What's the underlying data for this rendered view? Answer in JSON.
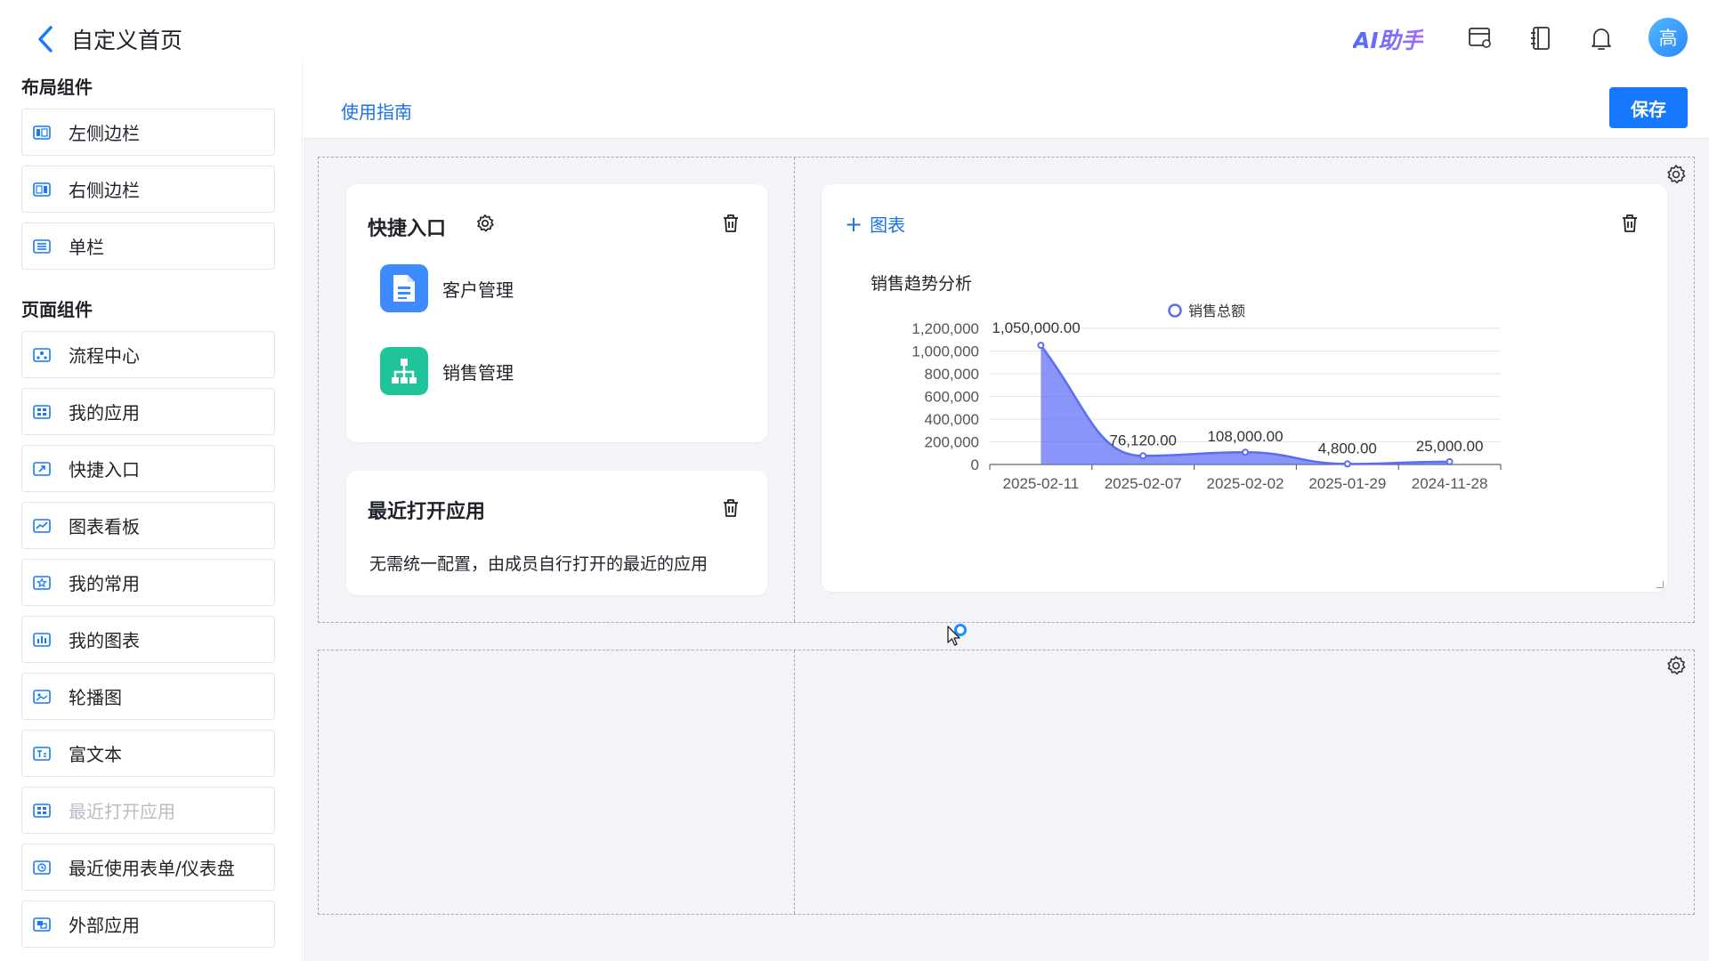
{
  "header": {
    "title": "自定义首页",
    "ai_label": "AI助手",
    "avatar_text": "高"
  },
  "sidebar": {
    "layout_section": "布局组件",
    "layout_items": [
      {
        "label": "左侧边栏",
        "icon": "left-sidebar-icon"
      },
      {
        "label": "右侧边栏",
        "icon": "right-sidebar-icon"
      },
      {
        "label": "单栏",
        "icon": "single-column-icon"
      }
    ],
    "page_section": "页面组件",
    "page_items": [
      {
        "label": "流程中心",
        "icon": "process-icon"
      },
      {
        "label": "我的应用",
        "icon": "apps-icon"
      },
      {
        "label": "快捷入口",
        "icon": "shortcut-icon"
      },
      {
        "label": "图表看板",
        "icon": "chart-board-icon"
      },
      {
        "label": "我的常用",
        "icon": "star-icon"
      },
      {
        "label": "我的图表",
        "icon": "bar-chart-icon"
      },
      {
        "label": "轮播图",
        "icon": "carousel-icon"
      },
      {
        "label": "富文本",
        "icon": "rich-text-icon"
      },
      {
        "label": "最近打开应用",
        "icon": "recent-apps-icon",
        "disabled": true
      },
      {
        "label": "最近使用表单/仪表盘",
        "icon": "clock-icon"
      },
      {
        "label": "外部应用",
        "icon": "external-app-icon"
      }
    ]
  },
  "toolbar": {
    "guide_label": "使用指南",
    "save_label": "保存"
  },
  "shortcut_card": {
    "title": "快捷入口",
    "items": [
      {
        "name": "客户管理",
        "color": "#3d8bff"
      },
      {
        "name": "销售管理",
        "color": "#1fc49a"
      }
    ]
  },
  "recent_card": {
    "title": "最近打开应用",
    "description": "无需统一配置，由成员自行打开的最近的应用"
  },
  "chart_card": {
    "add_label": "图表",
    "chart_title": "销售趋势分析"
  },
  "chart_data": {
    "type": "area",
    "title": "销售趋势分析",
    "categories": [
      "2025-02-11",
      "2025-02-07",
      "2025-02-02",
      "2025-01-29",
      "2024-11-28"
    ],
    "series": [
      {
        "name": "销售总额",
        "values": [
          1050000,
          76120,
          108000,
          4800,
          25000
        ],
        "color": "#5b6cf5"
      }
    ],
    "data_labels": [
      "1,050,000.00",
      "76,120.00",
      "108,000.00",
      "4,800.00",
      "25,000.00"
    ],
    "y_ticks": [
      "0",
      "200,000",
      "400,000",
      "600,000",
      "800,000",
      "1,000,000",
      "1,200,000"
    ],
    "ylim": [
      0,
      1200000
    ],
    "legend_position": "top",
    "grid": true
  }
}
